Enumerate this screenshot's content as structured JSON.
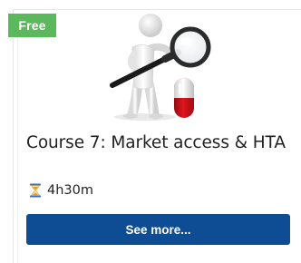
{
  "card": {
    "badge": "Free",
    "illustration": "magnifier-figure-pill-illustration",
    "title": "Course 7: Market access & HTA",
    "duration": {
      "icon": "hourglass-icon",
      "label": "4h30m"
    },
    "cta_label": "See more..."
  },
  "colors": {
    "badge": "#5cb85c",
    "button": "#0e4d94",
    "pill_red": "#d0101a",
    "text": "#222222"
  }
}
